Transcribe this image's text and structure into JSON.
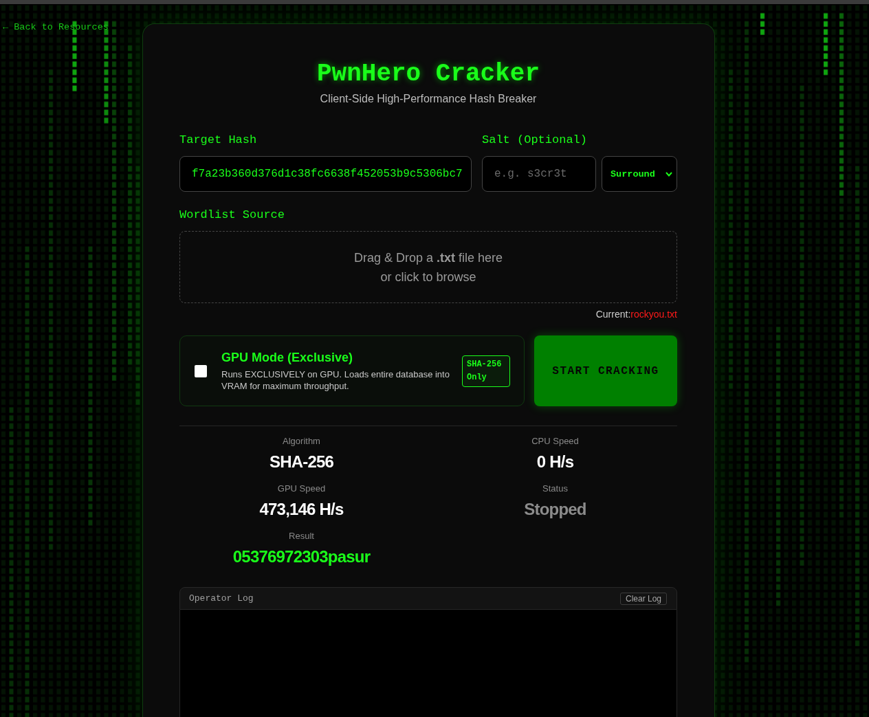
{
  "nav": {
    "back_link": "← Back to Resources"
  },
  "header": {
    "title": "PwnHero Cracker",
    "subtitle": "Client-Side High-Performance Hash Breaker"
  },
  "form": {
    "target_hash": {
      "label": "Target Hash",
      "value": "f7a23b360d376d1c38fc6638f452053b9c5306bc7"
    },
    "salt": {
      "label": "Salt (Optional)",
      "placeholder": "e.g. s3cr3t",
      "mode": "Surround"
    },
    "wordlist": {
      "label": "Wordlist Source",
      "drop_text": "Drag & Drop a **.txt** file here",
      "drop_hint": "or click to browse",
      "current_label": "Current:",
      "current_file": "rockyou.txt"
    }
  },
  "gpu_mode": {
    "checked": false,
    "title": "GPU Mode (Exclusive)",
    "description": "Runs EXCLUSIVELY on GPU. Loads entire database into VRAM for maximum throughput.",
    "badge": "SHA-256 Only"
  },
  "start_button": {
    "label": "START CRACKING"
  },
  "stats": [
    {
      "label": "Algorithm",
      "value": "SHA-256",
      "kind": "plain"
    },
    {
      "label": "CPU Speed",
      "value": "0 H/s",
      "kind": "plain"
    },
    {
      "label": "GPU Speed",
      "value": "473,146 H/s",
      "kind": "plain"
    },
    {
      "label": "Status",
      "value": "Stopped",
      "kind": "status"
    },
    {
      "label": "Result",
      "value": "05376972303pasur",
      "kind": "result"
    }
  ],
  "log": {
    "title": "Operator Log",
    "clear_button": "Clear Log"
  }
}
